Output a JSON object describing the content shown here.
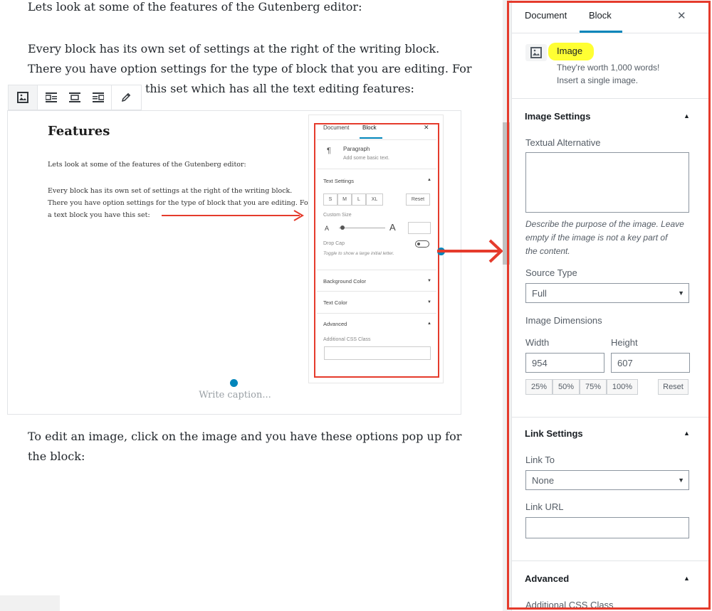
{
  "editor": {
    "para1": "Lets look at some of the features of the Gutenberg editor:",
    "para2_line1": "Every block has its own set of settings at the right of the writing block.",
    "para2_line2": "There you have option settings for the type of block that you are editing. For",
    "para2_line3_visible": "this set which has all the text editing features:",
    "para3_line1": "To edit an image, click on the image and you have these options pop up for",
    "para3_line2": "the block:",
    "caption_placeholder": "Write caption..."
  },
  "toolbar": {
    "icons": [
      "image-icon",
      "align-left-icon",
      "align-center-icon",
      "align-right-icon",
      "pencil-icon"
    ]
  },
  "embedded_screenshot": {
    "title": "Features",
    "line1": "Lets look at some of the features of the Gutenberg editor:",
    "line2": "Every block has its own set of settings at the right of the writing block.",
    "line3": "There you have option settings for the type of block that you are editing. For",
    "line4": "a text block you have this set:",
    "panel": {
      "tab_document": "Document",
      "tab_block": "Block",
      "close": "✕",
      "block_name": "Paragraph",
      "block_desc": "Add some basic text.",
      "text_settings": "Text Settings",
      "sizes": [
        "S",
        "M",
        "L",
        "XL"
      ],
      "reset": "Reset",
      "custom_size": "Custom Size",
      "small_a": "A",
      "big_a": "A",
      "drop_cap": "Drop Cap",
      "drop_cap_help": "Toggle to show a large initial letter.",
      "background_color": "Background Color",
      "text_color": "Text Color",
      "advanced": "Advanced",
      "additional_css": "Additional CSS Class"
    }
  },
  "sidebar": {
    "tab_document": "Document",
    "tab_block": "Block",
    "close": "✕",
    "block_name": "Image",
    "block_desc_line1": "They're worth 1,000 words!",
    "block_desc_line2": "Insert a single image.",
    "image_settings": "Image Settings",
    "textual_alternative": "Textual Alternative",
    "alt_help_line1": "Describe the purpose of the image. Leave",
    "alt_help_line2": "empty if the image is not a key part of",
    "alt_help_line3": "the content.",
    "source_type_label": "Source Type",
    "source_type_value": "Full",
    "image_dimensions": "Image Dimensions",
    "width_label": "Width",
    "height_label": "Height",
    "width_value": "954",
    "height_value": "607",
    "percent_buttons": [
      "25%",
      "50%",
      "75%",
      "100%"
    ],
    "reset": "Reset",
    "link_settings": "Link Settings",
    "link_to_label": "Link To",
    "link_to_value": "None",
    "link_url_label": "Link URL",
    "advanced": "Advanced",
    "additional_css": "Additional CSS Class"
  },
  "colors": {
    "annotation_red": "#e53b2c",
    "highlight_yellow": "#ffff33",
    "wp_blue": "#0085ba"
  }
}
